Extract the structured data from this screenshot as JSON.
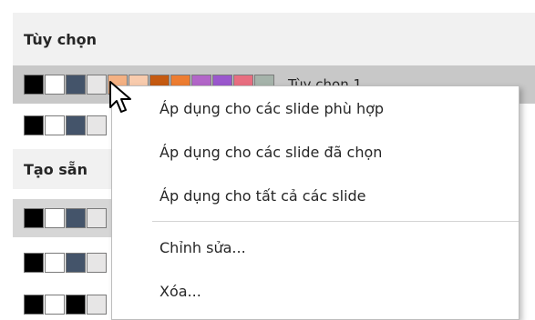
{
  "panel": {
    "custom_header": "Tùy chọn",
    "preset_header": "Tạo sẵn",
    "custom_schemes": [
      {
        "name": "Tùy chọn 1",
        "colors": [
          "#000000",
          "#ffffff",
          "#44546a",
          "#e7e6e6",
          "#f4b183",
          "#f8cbad",
          "#c55a11",
          "#ed7d31",
          "#b266c8",
          "#9a57cd",
          "#e86e80",
          "#a5b3aa"
        ]
      },
      {
        "colors": [
          "#000000",
          "#ffffff",
          "#44546a",
          "#e7e6e6"
        ]
      }
    ],
    "preset_schemes": [
      {
        "colors": [
          "#000000",
          "#ffffff",
          "#44546a",
          "#e7e6e6"
        ]
      },
      {
        "colors": [
          "#000000",
          "#ffffff",
          "#44546a",
          "#e7e6e6"
        ]
      },
      {
        "colors": [
          "#000000",
          "#ffffff",
          "#000000",
          "#e7e6e6"
        ]
      }
    ]
  },
  "context_menu": {
    "items": [
      "Áp dụng cho các slide phù hợp",
      "Áp dụng cho các slide đã chọn",
      "Áp dụng cho tất cả các slide",
      "Chỉnh sửa...",
      "Xóa..."
    ]
  },
  "icons": {
    "cursor": "mouse-pointer-icon"
  }
}
